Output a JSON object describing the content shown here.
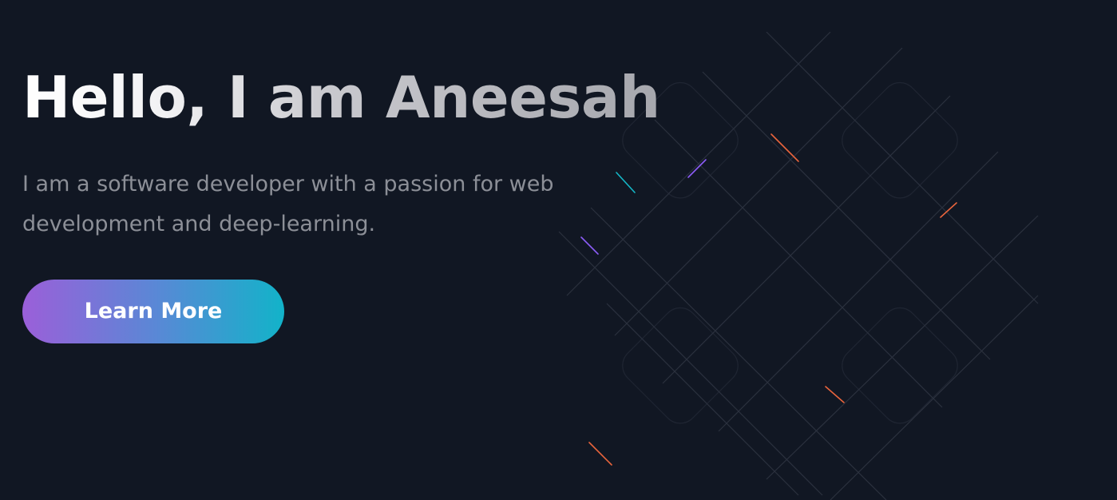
{
  "hero": {
    "headline": "Hello, I am Aneesah",
    "subtitle": "I am a software developer with a passion for web development and deep-learning.",
    "cta_label": "Learn More"
  },
  "colors": {
    "background": "#111723",
    "subtitle": "#8c8f97",
    "button_gradient_start": "#9b5fd9",
    "button_gradient_end": "#12b3c9",
    "pattern_line": "#2a303d",
    "accent_orange": "#e8643c",
    "accent_purple": "#8b5cf6",
    "accent_cyan": "#14b8c8"
  }
}
